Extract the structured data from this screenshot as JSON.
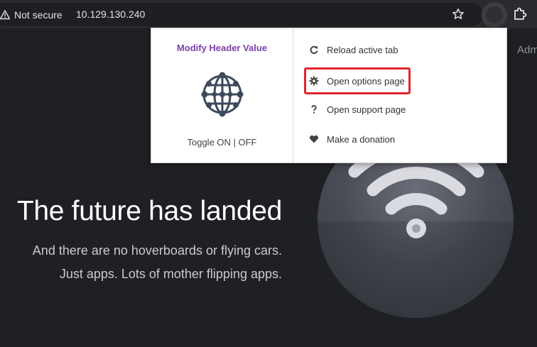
{
  "browser": {
    "security_label": "Not secure",
    "url": "10.129.130.240"
  },
  "page": {
    "nav_partial": "Adm",
    "hero_title": "The future has landed",
    "hero_line_1": "And there are no hoverboards or flying cars.",
    "hero_line_2": "Just apps. Lots of mother flipping apps."
  },
  "popup": {
    "extension_title": "Modify Header Value",
    "toggle_label": "Toggle ON | OFF",
    "menu": [
      {
        "label": "Reload active tab",
        "icon": "reload-icon"
      },
      {
        "label": "Open options page",
        "icon": "gear-icon",
        "highlighted": true
      },
      {
        "label": "Open support page",
        "icon": "question-icon"
      },
      {
        "label": "Make a donation",
        "icon": "heart-icon"
      }
    ]
  },
  "colors": {
    "extension_title": "#7b3fa8",
    "highlight_border": "#e0262e",
    "page_background": "#1f2024"
  }
}
